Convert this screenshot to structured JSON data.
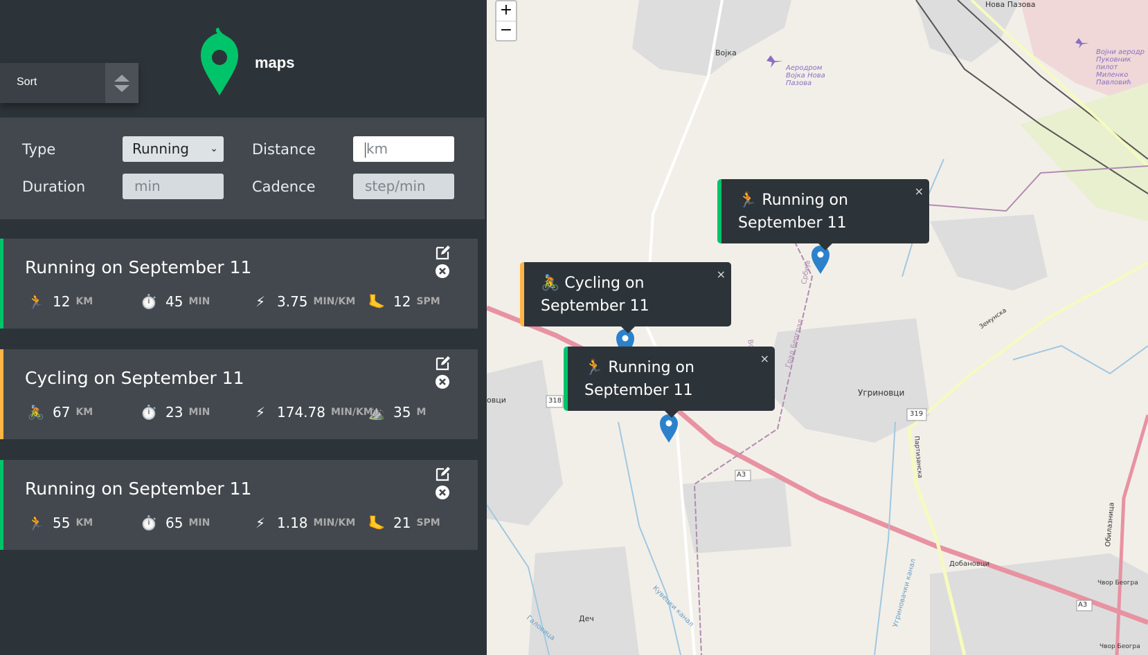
{
  "sidebar": {
    "sort": {
      "label": "Sort"
    },
    "logo": {
      "text": "maps",
      "color": "#00c46a"
    },
    "form": {
      "type_label": "Type",
      "type_value": "Running",
      "distance_label": "Distance",
      "distance_placeholder": "km",
      "duration_label": "Duration",
      "duration_placeholder": "min",
      "cadence_label": "Cadence",
      "cadence_placeholder": "step/min"
    },
    "workouts": [
      {
        "title": "Running on September 11",
        "type": "running",
        "accent": "#00c46a",
        "stats": [
          {
            "icon": "runner-icon",
            "value": "12",
            "unit": "km"
          },
          {
            "icon": "stopwatch-icon",
            "value": "45",
            "unit": "min"
          },
          {
            "icon": "lightning-icon",
            "value": "3.75",
            "unit": "min/km"
          },
          {
            "icon": "foot-icon",
            "value": "12",
            "unit": "spm"
          }
        ]
      },
      {
        "title": "Cycling on September 11",
        "type": "cycling",
        "accent": "#ffb545",
        "stats": [
          {
            "icon": "cyclist-icon",
            "value": "67",
            "unit": "km"
          },
          {
            "icon": "stopwatch-icon",
            "value": "23",
            "unit": "min"
          },
          {
            "icon": "lightning-icon",
            "value": "174.78",
            "unit": "min/km"
          },
          {
            "icon": "mountain-icon",
            "value": "35",
            "unit": "m"
          }
        ]
      },
      {
        "title": "Running on September 11",
        "type": "running",
        "accent": "#00c46a",
        "stats": [
          {
            "icon": "runner-icon",
            "value": "55",
            "unit": "km"
          },
          {
            "icon": "stopwatch-icon",
            "value": "65",
            "unit": "min"
          },
          {
            "icon": "lightning-icon",
            "value": "1.18",
            "unit": "min/km"
          },
          {
            "icon": "foot-icon",
            "value": "21",
            "unit": "spm"
          }
        ]
      }
    ]
  },
  "map": {
    "zoom_in": "+",
    "zoom_out": "−",
    "popups": [
      {
        "line1": "Running on",
        "line2": "September 11",
        "type": "running",
        "close": "×"
      },
      {
        "line1": "Cycling on",
        "line2": "September 11",
        "type": "cycling",
        "close": "×"
      },
      {
        "line1": "Running on",
        "line2": "September 11",
        "type": "running",
        "close": "×"
      }
    ],
    "labels": {
      "vojka": "Војка",
      "nova_pazova": "Нова Пазова",
      "airport": "Аеродром Војка Нова Пазова",
      "military_airport": "Војни аеродр Пуковник пилот Миленко Павловић",
      "ugrinovci": "Угриновци",
      "dobanovci": "Добановци",
      "dec": "Деч",
      "ovci": "овци",
      "a3_1": "A3",
      "a3_2": "A3",
      "r319": "319",
      "r318": "318",
      "cvor1": "Чвор Београ",
      "cvor2": "Чвор Београ",
      "vojvodina": "Војводина",
      "grad_beograd": "Град Београд",
      "partizanska": "Партизанска",
      "zemunska": "Земунска",
      "kuvecki": "Кувецки канал",
      "galovica": "Галовица",
      "ugrinovacki": "Угриновачки канал",
      "obilaznica": "Обилазница",
      "srbija": "Србија"
    }
  }
}
